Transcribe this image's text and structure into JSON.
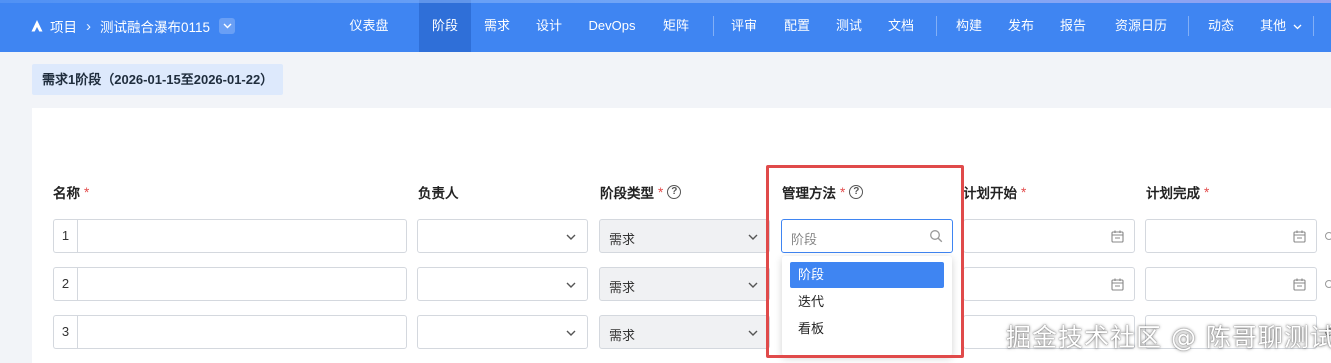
{
  "breadcrumb": {
    "root": "项目",
    "project": "测试融合瀑布0115"
  },
  "nav": {
    "items": [
      {
        "label": "仪表盘"
      },
      {
        "label": "阶段",
        "active": true
      },
      {
        "label": "需求"
      },
      {
        "label": "设计"
      },
      {
        "label": "DevOps"
      },
      {
        "label": "矩阵"
      },
      {
        "label": "评审"
      },
      {
        "label": "配置"
      },
      {
        "label": "测试"
      },
      {
        "label": "文档"
      },
      {
        "label": "构建"
      },
      {
        "label": "发布"
      },
      {
        "label": "报告"
      },
      {
        "label": "资源日历"
      },
      {
        "label": "动态"
      },
      {
        "label": "其他"
      }
    ]
  },
  "stage_tab": {
    "label": "需求1阶段（2026-01-15至2026-01-22）"
  },
  "columns": {
    "name": "名称",
    "owner": "负责人",
    "stage_type": "阶段类型",
    "method": "管理方法",
    "plan_start": "计划开始",
    "plan_end": "计划完成",
    "required_mark": "*"
  },
  "rows": [
    {
      "index": "1",
      "stage_type": "需求"
    },
    {
      "index": "2",
      "stage_type": "需求"
    },
    {
      "index": "3",
      "stage_type": "需求"
    }
  ],
  "method_dropdown": {
    "placeholder": "阶段",
    "options": [
      "阶段",
      "迭代",
      "看板"
    ],
    "selected": "阶段"
  },
  "watermark": "掘金技术社区 @ 陈哥聊测试",
  "colors": {
    "nav_bg": "#3f85f2",
    "accent": "#3f85f2",
    "required": "#e34d4d",
    "highlight": "#e04a4a"
  }
}
